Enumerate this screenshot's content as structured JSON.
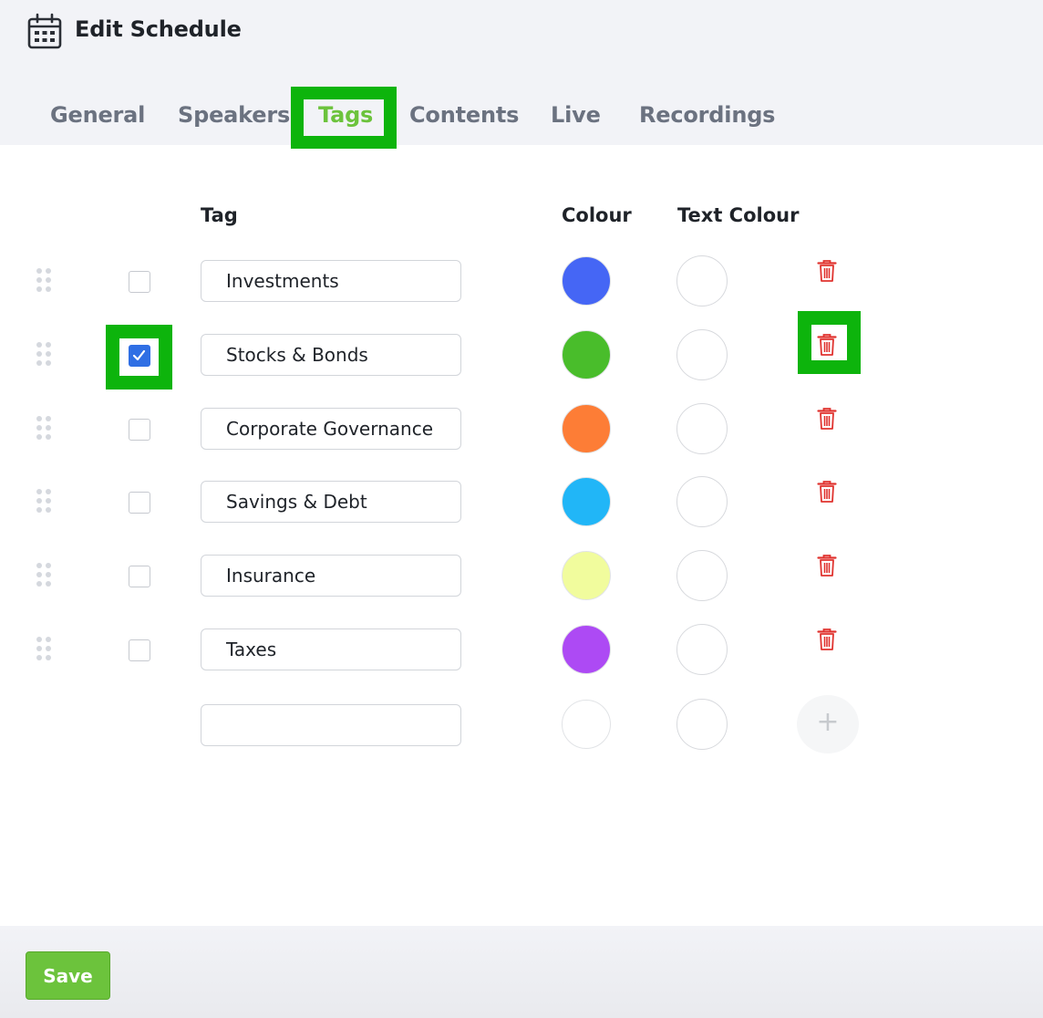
{
  "header": {
    "title": "Edit Schedule",
    "icon": "calendar-icon"
  },
  "tabs": [
    {
      "label": "General",
      "active": false
    },
    {
      "label": "Speakers",
      "active": false
    },
    {
      "label": "Tags",
      "active": true
    },
    {
      "label": "Contents",
      "active": false
    },
    {
      "label": "Live",
      "active": false
    },
    {
      "label": "Recordings",
      "active": false
    }
  ],
  "columns": {
    "tag": "Tag",
    "colour": "Colour",
    "text_colour": "Text Colour"
  },
  "tags": [
    {
      "name": "Investments",
      "checked": false,
      "colour": "#4566f5",
      "text_colour": "#ffffff"
    },
    {
      "name": "Stocks & Bonds",
      "checked": true,
      "colour": "#49bd2b",
      "text_colour": "#ffffff"
    },
    {
      "name": "Corporate Governance",
      "checked": false,
      "colour": "#fd7d36",
      "text_colour": "#ffffff"
    },
    {
      "name": "Savings & Debt",
      "checked": false,
      "colour": "#21b6f7",
      "text_colour": "#ffffff"
    },
    {
      "name": "Insurance",
      "checked": false,
      "colour": "#f1fc9d",
      "text_colour": "#ffffff"
    },
    {
      "name": "Taxes",
      "checked": false,
      "colour": "#ad4af4",
      "text_colour": "#ffffff"
    }
  ],
  "new_tag": {
    "value": "",
    "placeholder": "",
    "colour": "#e8e8e8",
    "text_colour": "#ffffff"
  },
  "icons": {
    "drag": "drag-handle-icon",
    "delete": "trash-icon",
    "add": "plus-icon"
  },
  "add_symbol": "+",
  "footer": {
    "save_label": "Save"
  },
  "colors": {
    "accent": "#6cc33c",
    "delete": "#e0332f",
    "highlight": "#0db40c",
    "checkbox": "#2f6fe4"
  }
}
